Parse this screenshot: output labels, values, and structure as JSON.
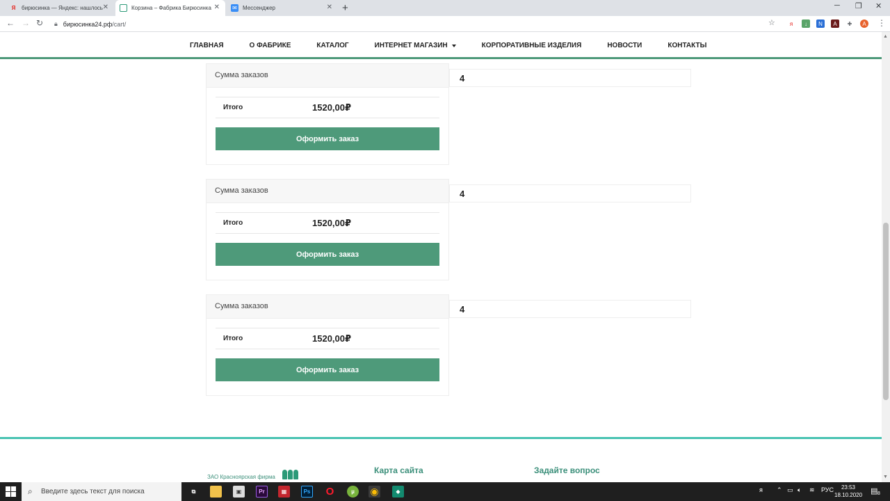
{
  "browser": {
    "tabs": [
      {
        "title": "бирюсинка — Яндекс: нашлось",
        "icon": "yandex-icon"
      },
      {
        "title": "Корзина – Фабрика Бирюсинка",
        "icon": "biryusinka-icon"
      },
      {
        "title": "Мессенджер",
        "icon": "messenger-icon"
      }
    ],
    "new_tab": "+",
    "address": {
      "host": "бирюсинка24.рф",
      "path": "/cart/"
    }
  },
  "nav": {
    "items": [
      "ГЛАВНАЯ",
      "О ФАБРИКЕ",
      "КАТАЛОГ",
      "ИНТЕРНЕТ МАГАЗИН",
      "КОРПОРАТИВНЫЕ ИЗДЕЛИЯ",
      "НОВОСТИ",
      "КОНТАКТЫ"
    ]
  },
  "orders": [
    {
      "heading": "Сумма заказов",
      "total_label": "Итого",
      "total_value": "1520,00₽",
      "button": "Оформить заказ",
      "qty": "4"
    },
    {
      "heading": "Сумма заказов",
      "total_label": "Итого",
      "total_value": "1520,00₽",
      "button": "Оформить заказ",
      "qty": "4"
    },
    {
      "heading": "Сумма заказов",
      "total_label": "Итого",
      "total_value": "1520,00₽",
      "button": "Оформить заказ",
      "qty": "4"
    }
  ],
  "footer": {
    "company": "ЗАО Красноярская фирма",
    "sitemap": "Карта сайта",
    "ask": "Задайте вопрос"
  },
  "taskbar": {
    "search_placeholder": "Введите здесь текст для поиска",
    "lang": "РУС",
    "time": "23:53",
    "date": "18.10.2020",
    "notif_count": "8"
  },
  "colors": {
    "accent": "#4e9a7a",
    "footer_line": "#47c2b1"
  }
}
